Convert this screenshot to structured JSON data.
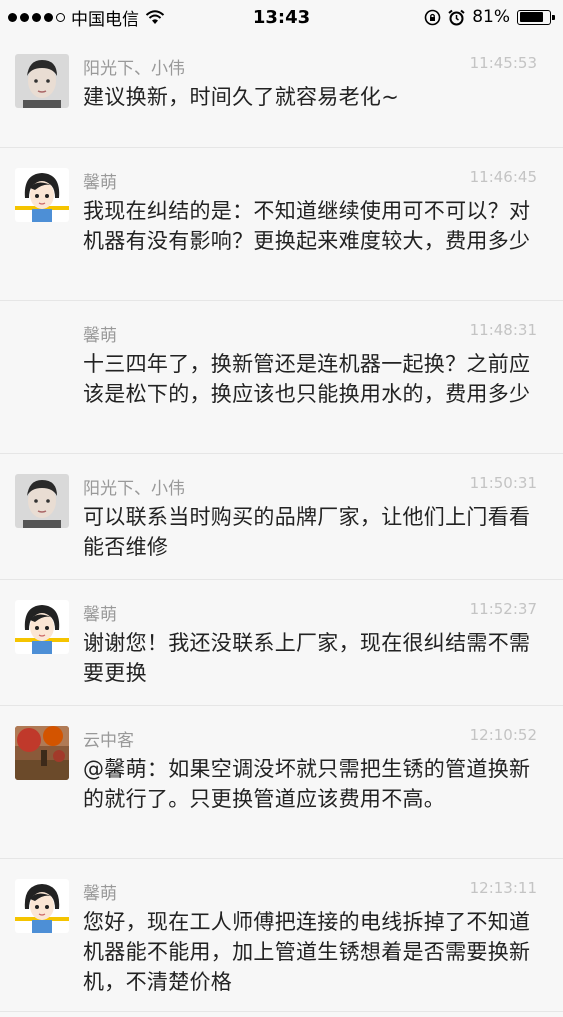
{
  "status_bar": {
    "carrier": "中国电信",
    "time": "13:43",
    "battery": "81%",
    "battery_level": 0.81
  },
  "messages": [
    {
      "name": "阳光下、小伟",
      "time": "11:45:53",
      "text": "建议换新，时间久了就容易老化~",
      "avatar": "boy-photo"
    },
    {
      "name": "馨萌",
      "time": "11:46:45",
      "text": "我现在纠结的是：不知道继续使用可不可以？对机器有没有影响？更换起来难度较大，费用多少",
      "avatar": "cartoon-girl"
    },
    {
      "name": "馨萌",
      "time": "11:48:31",
      "text": "十三四年了，换新管还是连机器一起换？之前应该是松下的，换应该也只能换用水的，费用多少",
      "avatar": ""
    },
    {
      "name": "阳光下、小伟",
      "time": "11:50:31",
      "text": "可以联系当时购买的品牌厂家，让他们上门看看能否维修",
      "avatar": "boy-photo"
    },
    {
      "name": "馨萌",
      "time": "11:52:37",
      "text": "谢谢您！我还没联系上厂家，现在很纠结需不需要更换",
      "avatar": "cartoon-girl"
    },
    {
      "name": "云中客",
      "time": "12:10:52",
      "text": "@馨萌：如果空调没坏就只需把生锈的管道换新的就行了。只更换管道应该费用不高。",
      "avatar": "landscape-photo"
    },
    {
      "name": "馨萌",
      "time": "12:13:11",
      "text": "您好，现在工人师傅把连接的电线拆掉了不知道机器能不能用，加上管道生锈想着是否需要换新机，不清楚价格",
      "avatar": "cartoon-girl"
    }
  ]
}
